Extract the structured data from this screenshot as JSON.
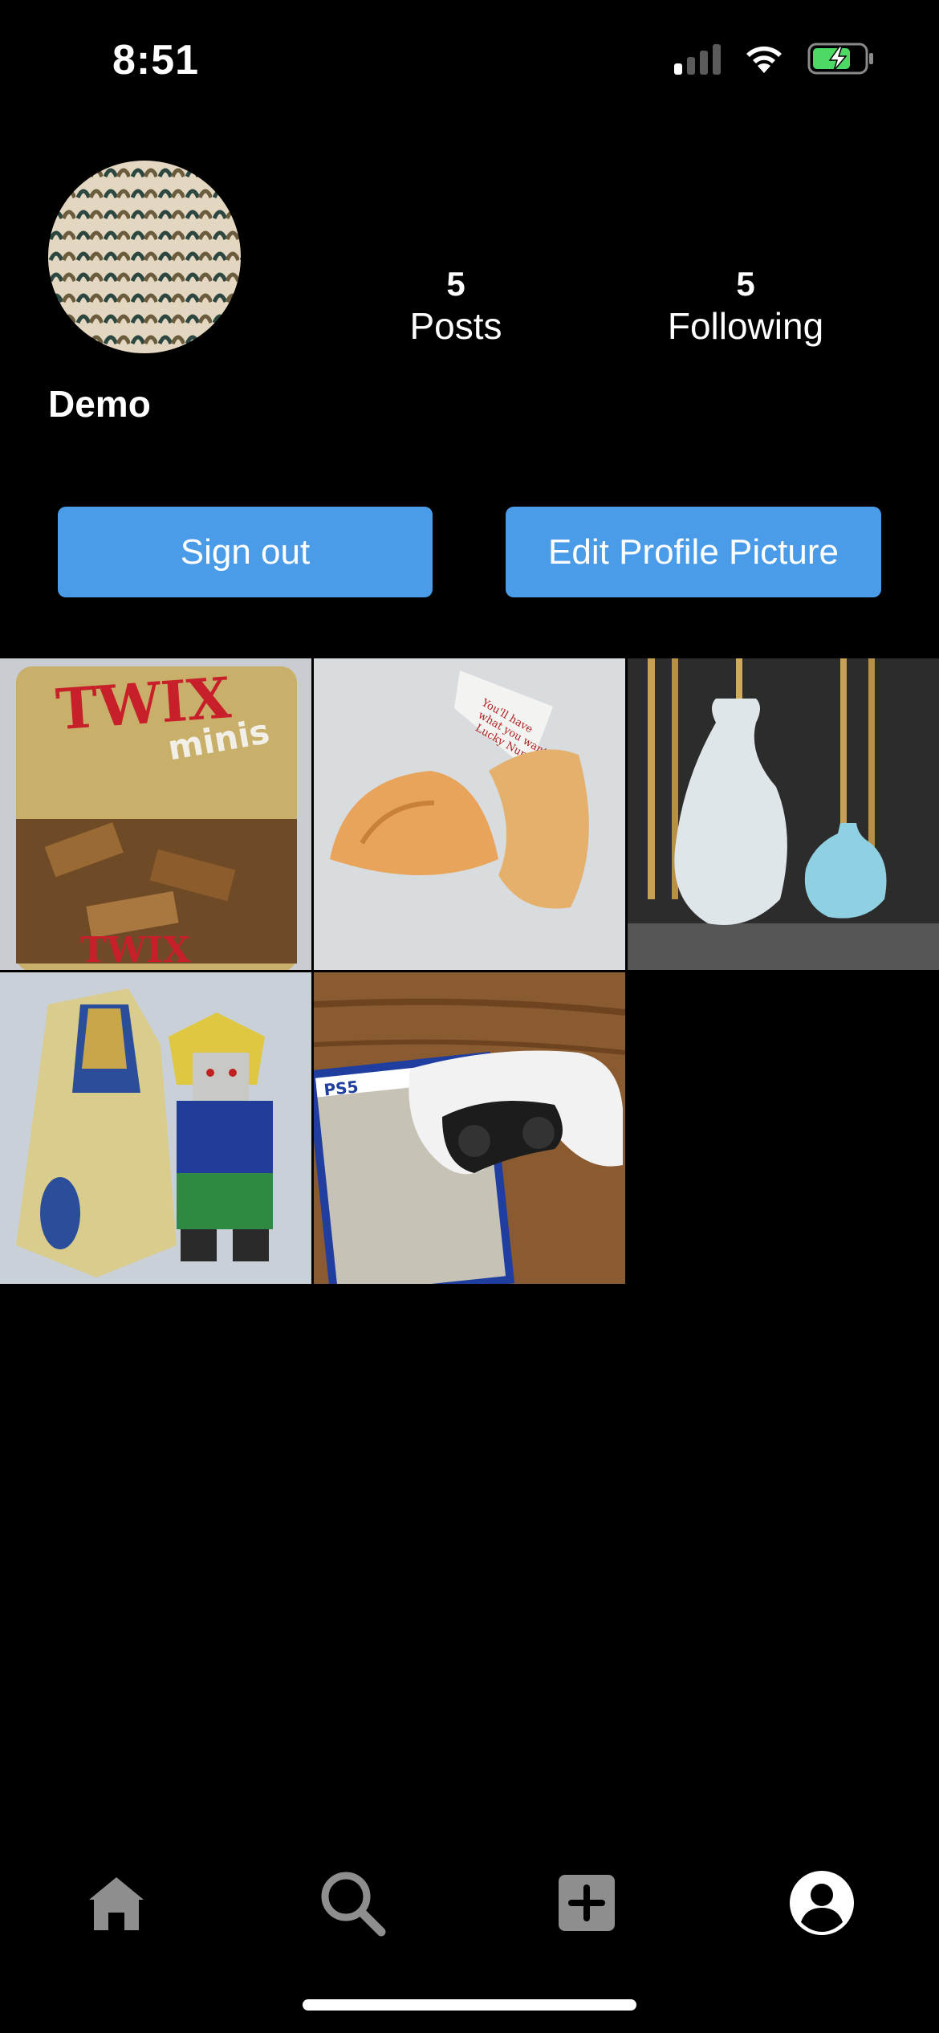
{
  "status_bar": {
    "time": "8:51"
  },
  "profile": {
    "username": "Demo",
    "posts_count": "5",
    "posts_label": "Posts",
    "following_count": "5",
    "following_label": "Following"
  },
  "actions": {
    "sign_out_label": "Sign out",
    "edit_picture_label": "Edit Profile Picture"
  },
  "posts": [
    {
      "subject": "Twix minis candy bag",
      "visible_text": "TWIX minis"
    },
    {
      "subject": "Fortune cookie",
      "visible_text": "You'll have what you want Lucky Numbers"
    },
    {
      "subject": "Two ceramic vases"
    },
    {
      "subject": "Lego pharaoh minifigure with sarcophagus"
    },
    {
      "subject": "PS5 controller on game case",
      "visible_text": "PS5"
    }
  ],
  "tab_bar": {
    "items": [
      "home-icon",
      "search-icon",
      "add-post-icon",
      "profile-icon"
    ],
    "active": "profile-icon"
  },
  "colors": {
    "background": "#000000",
    "button": "#4a9be8",
    "tab_inactive": "#8e8e8e",
    "tab_active": "#ffffff",
    "battery": "#4cd964"
  }
}
